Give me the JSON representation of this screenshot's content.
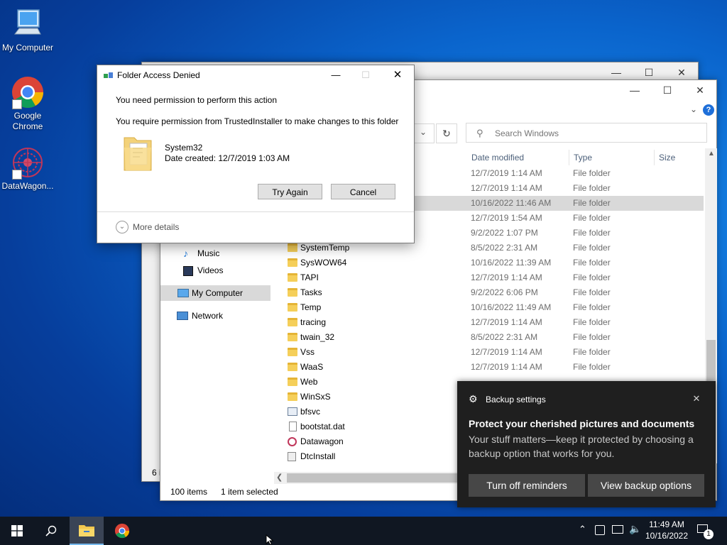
{
  "desktop": {
    "icons": [
      {
        "label": "My Computer"
      },
      {
        "label": "Google Chrome"
      },
      {
        "label": "DataWagon..."
      }
    ]
  },
  "back_window": {
    "status_fragment": "6 i"
  },
  "explorer": {
    "search_placeholder": "Search Windows",
    "columns": {
      "date": "Date modified",
      "type": "Type",
      "size": "Size"
    },
    "status": {
      "count": "100 items",
      "selected": "1 item selected"
    },
    "nav": [
      {
        "label": "Music"
      },
      {
        "label": "Videos"
      },
      {
        "label": "My Computer"
      },
      {
        "label": "Network"
      }
    ],
    "top_rows": [
      {
        "date": "12/7/2019 1:14 AM",
        "type": "File folder"
      },
      {
        "date": "12/7/2019 1:14 AM",
        "type": "File folder"
      },
      {
        "date": "10/16/2022 11:46 AM",
        "type": "File folder"
      },
      {
        "date": "12/7/2019 1:54 AM",
        "type": "File folder"
      },
      {
        "date": "9/2/2022 1:07 PM",
        "type": "File folder"
      }
    ],
    "rows": [
      {
        "name": "SystemTemp",
        "date": "8/5/2022 2:31 AM",
        "type": "File folder"
      },
      {
        "name": "SysWOW64",
        "date": "10/16/2022 11:39 AM",
        "type": "File folder"
      },
      {
        "name": "TAPI",
        "date": "12/7/2019 1:14 AM",
        "type": "File folder"
      },
      {
        "name": "Tasks",
        "date": "9/2/2022 6:06 PM",
        "type": "File folder"
      },
      {
        "name": "Temp",
        "date": "10/16/2022 11:49 AM",
        "type": "File folder"
      },
      {
        "name": "tracing",
        "date": "12/7/2019 1:14 AM",
        "type": "File folder"
      },
      {
        "name": "twain_32",
        "date": "8/5/2022 2:31 AM",
        "type": "File folder"
      },
      {
        "name": "Vss",
        "date": "12/7/2019 1:14 AM",
        "type": "File folder"
      },
      {
        "name": "WaaS",
        "date": "12/7/2019 1:14 AM",
        "type": "File folder"
      },
      {
        "name": "Web",
        "date": "",
        "type": ""
      },
      {
        "name": "WinSxS",
        "date": "",
        "type": ""
      },
      {
        "name": "bfsvc",
        "date": "",
        "type": ""
      },
      {
        "name": "bootstat.dat",
        "date": "",
        "type": ""
      },
      {
        "name": "Datawagon",
        "date": "",
        "type": ""
      },
      {
        "name": "DtcInstall",
        "date": "",
        "type": ""
      }
    ]
  },
  "dialog": {
    "title": "Folder Access Denied",
    "message": "You need permission to perform this action",
    "detail": "You require permission from TrustedInstaller to make changes to this folder",
    "folder_name": "System32",
    "date_created": "Date created: 12/7/2019 1:03 AM",
    "try_again": "Try Again",
    "cancel": "Cancel",
    "more_details": "More details"
  },
  "toast": {
    "app": "Backup settings",
    "title": "Protect your cherished pictures and documents",
    "body": "Your stuff matters—keep it protected by choosing a backup option that works for you.",
    "btn_off": "Turn off reminders",
    "btn_view": "View backup options"
  },
  "taskbar": {
    "time": "11:49 AM",
    "date": "10/16/2022",
    "notification_count": "1"
  },
  "colors": {
    "selection": "#cce8ff",
    "highlight_row": "#d9d9d9",
    "taskbar": "#101722",
    "toast": "#1f1f1f"
  }
}
